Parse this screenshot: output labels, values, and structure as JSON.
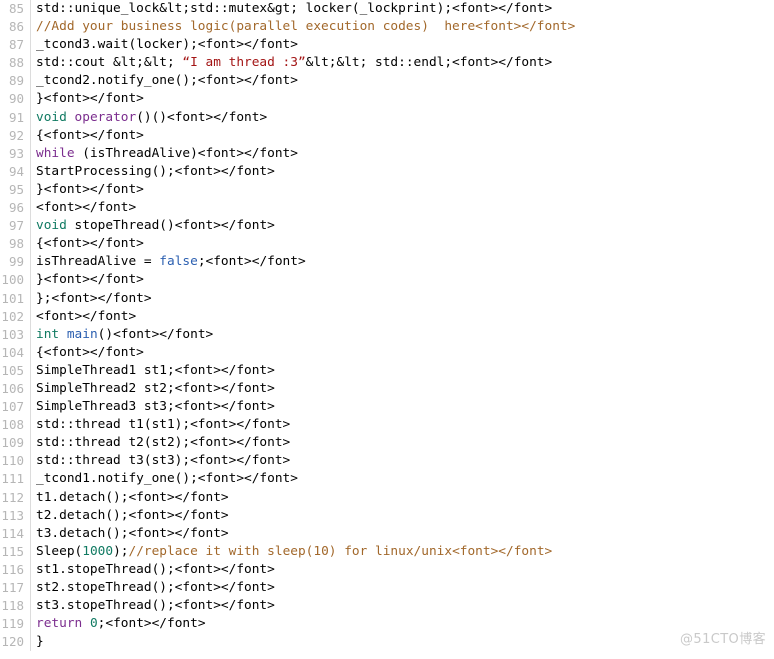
{
  "viewer": {
    "name": "code-snippet-viewer",
    "language": "C++",
    "first_line": 85,
    "last_line": 120,
    "colors": {
      "background": "#ffffff",
      "text": "#000000",
      "line_number": "#b6b6b6",
      "gutter_border": "#dcdcdc",
      "keyword": "#7b2d8e",
      "type": "#107a62",
      "function": "#2b5fb0",
      "literal": "#2b5fb0",
      "number": "#107a62",
      "comment": "#a2682b",
      "string": "#a31515",
      "watermark": "#c9c9c9"
    }
  },
  "watermark": {
    "text": "@51CTO博客"
  },
  "lines": [
    {
      "number": "85",
      "tokens": [
        {
          "t": "std::unique_lock&lt;std::mutex&gt; locker(_lockprint);<font></font>",
          "c": "plain"
        }
      ]
    },
    {
      "number": "86",
      "tokens": [
        {
          "t": "//Add your business logic(parallel execution codes)  here<font></font>",
          "c": "comment"
        }
      ]
    },
    {
      "number": "87",
      "tokens": [
        {
          "t": "_tcond3.wait(locker);<font></font>",
          "c": "plain"
        }
      ]
    },
    {
      "number": "88",
      "tokens": [
        {
          "t": "std::cout &lt;&lt; ",
          "c": "plain"
        },
        {
          "t": "“I am thread :3”",
          "c": "string"
        },
        {
          "t": "&lt;&lt; std::endl;<font></font>",
          "c": "plain"
        }
      ]
    },
    {
      "number": "89",
      "tokens": [
        {
          "t": "_tcond2.notify_one();<font></font>",
          "c": "plain"
        }
      ]
    },
    {
      "number": "90",
      "tokens": [
        {
          "t": "}<font></font>",
          "c": "plain"
        }
      ]
    },
    {
      "number": "91",
      "tokens": [
        {
          "t": "void",
          "c": "type"
        },
        {
          "t": " ",
          "c": "plain"
        },
        {
          "t": "operator",
          "c": "kw"
        },
        {
          "t": "()()<font></font>",
          "c": "plain"
        }
      ]
    },
    {
      "number": "92",
      "tokens": [
        {
          "t": "{<font></font>",
          "c": "plain"
        }
      ]
    },
    {
      "number": "93",
      "tokens": [
        {
          "t": "while",
          "c": "kw"
        },
        {
          "t": " (isThreadAlive)<font></font>",
          "c": "plain"
        }
      ]
    },
    {
      "number": "94",
      "tokens": [
        {
          "t": "StartProcessing();<font></font>",
          "c": "plain"
        }
      ]
    },
    {
      "number": "95",
      "tokens": [
        {
          "t": "}<font></font>",
          "c": "plain"
        }
      ]
    },
    {
      "number": "96",
      "tokens": [
        {
          "t": "<font></font>",
          "c": "plain"
        }
      ]
    },
    {
      "number": "97",
      "tokens": [
        {
          "t": "void",
          "c": "type"
        },
        {
          "t": " stopeThread()<font></font>",
          "c": "plain"
        }
      ]
    },
    {
      "number": "98",
      "tokens": [
        {
          "t": "{<font></font>",
          "c": "plain"
        }
      ]
    },
    {
      "number": "99",
      "tokens": [
        {
          "t": "isThreadAlive = ",
          "c": "plain"
        },
        {
          "t": "false",
          "c": "lit"
        },
        {
          "t": ";<font></font>",
          "c": "plain"
        }
      ]
    },
    {
      "number": "100",
      "tokens": [
        {
          "t": "}<font></font>",
          "c": "plain"
        }
      ]
    },
    {
      "number": "101",
      "tokens": [
        {
          "t": "};<font></font>",
          "c": "plain"
        }
      ]
    },
    {
      "number": "102",
      "tokens": [
        {
          "t": "<font></font>",
          "c": "plain"
        }
      ]
    },
    {
      "number": "103",
      "tokens": [
        {
          "t": "int",
          "c": "type"
        },
        {
          "t": " ",
          "c": "plain"
        },
        {
          "t": "main",
          "c": "fn"
        },
        {
          "t": "()<font></font>",
          "c": "plain"
        }
      ]
    },
    {
      "number": "104",
      "tokens": [
        {
          "t": "{<font></font>",
          "c": "plain"
        }
      ]
    },
    {
      "number": "105",
      "tokens": [
        {
          "t": "SimpleThread1 st1;<font></font>",
          "c": "plain"
        }
      ]
    },
    {
      "number": "106",
      "tokens": [
        {
          "t": "SimpleThread2 st2;<font></font>",
          "c": "plain"
        }
      ]
    },
    {
      "number": "107",
      "tokens": [
        {
          "t": "SimpleThread3 st3;<font></font>",
          "c": "plain"
        }
      ]
    },
    {
      "number": "108",
      "tokens": [
        {
          "t": "std::thread t1(st1);<font></font>",
          "c": "plain"
        }
      ]
    },
    {
      "number": "109",
      "tokens": [
        {
          "t": "std::thread t2(st2);<font></font>",
          "c": "plain"
        }
      ]
    },
    {
      "number": "110",
      "tokens": [
        {
          "t": "std::thread t3(st3);<font></font>",
          "c": "plain"
        }
      ]
    },
    {
      "number": "111",
      "tokens": [
        {
          "t": "_tcond1.notify_one();<font></font>",
          "c": "plain"
        }
      ]
    },
    {
      "number": "112",
      "tokens": [
        {
          "t": "t1.detach();<font></font>",
          "c": "plain"
        }
      ]
    },
    {
      "number": "113",
      "tokens": [
        {
          "t": "t2.detach();<font></font>",
          "c": "plain"
        }
      ]
    },
    {
      "number": "114",
      "tokens": [
        {
          "t": "t3.detach();<font></font>",
          "c": "plain"
        }
      ]
    },
    {
      "number": "115",
      "tokens": [
        {
          "t": "Sleep(",
          "c": "plain"
        },
        {
          "t": "1000",
          "c": "num"
        },
        {
          "t": ");",
          "c": "plain"
        },
        {
          "t": "//replace it with sleep(10) for linux/unix<font></font>",
          "c": "comment"
        }
      ]
    },
    {
      "number": "116",
      "tokens": [
        {
          "t": "st1.stopeThread();<font></font>",
          "c": "plain"
        }
      ]
    },
    {
      "number": "117",
      "tokens": [
        {
          "t": "st2.stopeThread();<font></font>",
          "c": "plain"
        }
      ]
    },
    {
      "number": "118",
      "tokens": [
        {
          "t": "st3.stopeThread();<font></font>",
          "c": "plain"
        }
      ]
    },
    {
      "number": "119",
      "tokens": [
        {
          "t": "return",
          "c": "kw"
        },
        {
          "t": " ",
          "c": "plain"
        },
        {
          "t": "0",
          "c": "num"
        },
        {
          "t": ";<font></font>",
          "c": "plain"
        }
      ]
    },
    {
      "number": "120",
      "tokens": [
        {
          "t": "}",
          "c": "plain"
        }
      ]
    }
  ]
}
